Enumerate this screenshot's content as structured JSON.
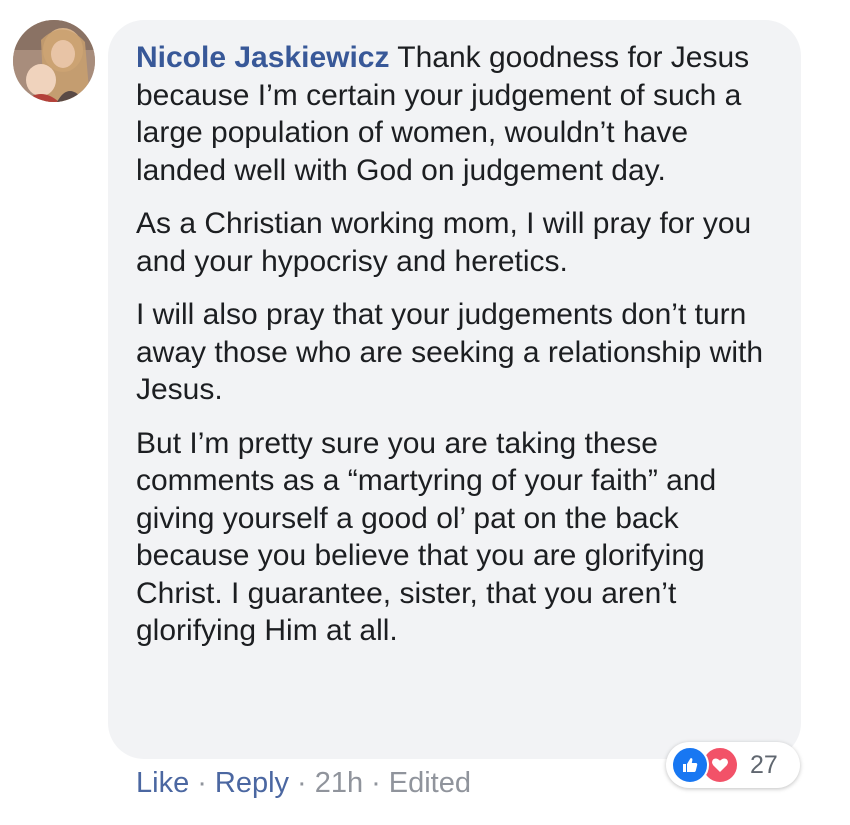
{
  "comment": {
    "author": "Nicole Jaskiewicz",
    "paragraphs": [
      "Thank goodness for Jesus because I’m certain your judgement of such a large population of women, wouldn’t have landed well with God on judgement day.",
      "As a Christian working mom, I will pray for you and your hypocrisy and heretics.",
      "I will also pray that your judgements don’t turn away those who are seeking a relationship with Jesus.",
      "But I’m pretty sure you are taking these comments as a “martyring of your faith” and giving yourself a good ol’ pat on the back because you believe that you are glorifying Christ. I guarantee, sister, that you aren’t glorifying Him at all."
    ]
  },
  "actions": {
    "like": "Like",
    "reply": "Reply",
    "time": "21h",
    "edited": "Edited",
    "separator": "·"
  },
  "reactions": {
    "count": "27",
    "icons": [
      "like-icon",
      "love-icon"
    ],
    "colors": {
      "like": "#1877f2",
      "love": "#f25268"
    }
  },
  "colors": {
    "author": "#385898",
    "bubble": "#f2f3f5",
    "action_link": "#4b67a1",
    "meta": "#90949c"
  }
}
